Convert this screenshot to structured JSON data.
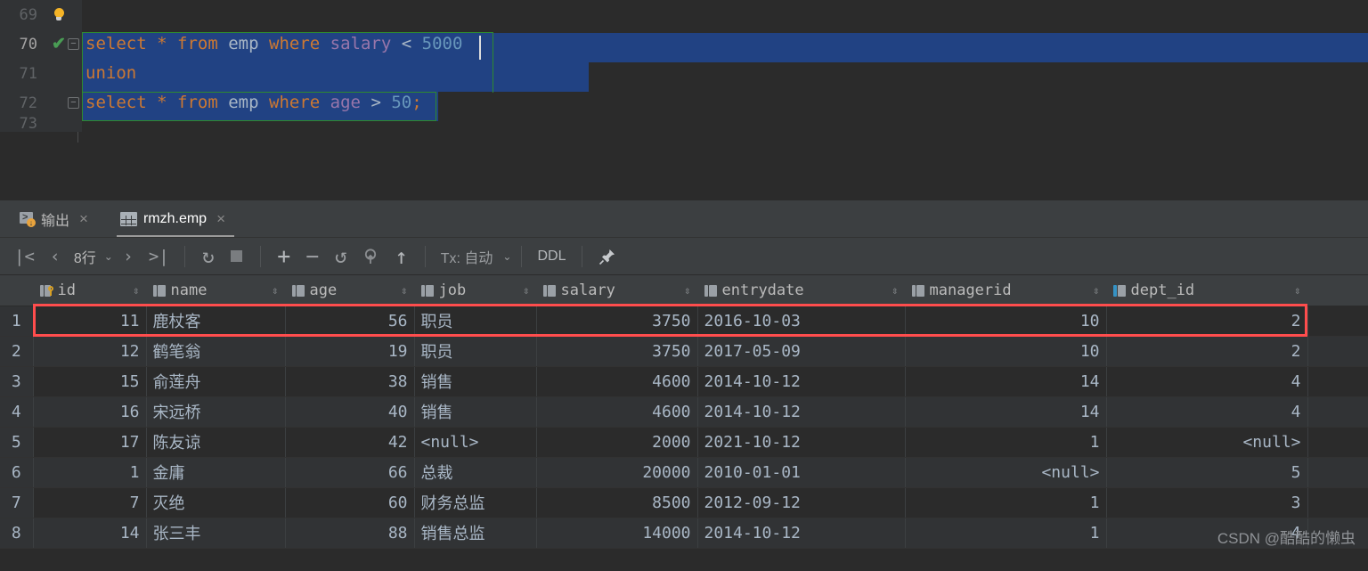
{
  "editor": {
    "lines": [
      {
        "number": "69",
        "gutter": "bulb-icon",
        "text": ""
      },
      {
        "number": "70",
        "gutter": "check-icon",
        "text": "select * from emp where salary < 5000"
      },
      {
        "number": "71",
        "gutter": "",
        "text": "union"
      },
      {
        "number": "72",
        "gutter": "fold-icon",
        "text": "select * from emp where age > 50;"
      },
      {
        "number": "73",
        "gutter": "",
        "text": ""
      }
    ],
    "line70": {
      "kw_select": "select",
      "star": "*",
      "kw_from": "from",
      "table": "emp",
      "kw_where": "where",
      "column": "salary",
      "operator": "<",
      "value": "5000"
    },
    "line71": {
      "kw_union": "union"
    },
    "line72": {
      "kw_select": "select",
      "star": "*",
      "kw_from": "from",
      "table": "emp",
      "kw_where": "where",
      "column": "age",
      "operator": ">",
      "value": "50",
      "semicolon": ";"
    },
    "colors": {
      "background": "#2b2b2b",
      "selection": "#214283",
      "keyword": "#cc7832",
      "number": "#6897bb",
      "column": "#9876aa",
      "identifier": "#a9b7c6",
      "statement_border": "#2e8b2e",
      "check": "#499c54"
    }
  },
  "tabs": {
    "items": [
      {
        "label": "输出",
        "icon": "output-icon",
        "close": "×",
        "active": false
      },
      {
        "label": "rmzh.emp",
        "icon": "table-grid-icon",
        "close": "×",
        "active": true
      }
    ]
  },
  "toolbar": {
    "first_page": "|<",
    "prev_page": "‹",
    "row_count": "8行",
    "row_count_caret": "⌄",
    "next_page": "›",
    "last_page": ">|",
    "reload": "↻",
    "stop": "stop-icon",
    "add_row": "+",
    "delete_row": "−",
    "revert": "↺",
    "find": "find-icon",
    "submit": "↑",
    "tx_label": "Tx: 自动",
    "tx_caret": "⌄",
    "ddl": "DDL",
    "pin": "pin-icon"
  },
  "grid": {
    "row_header": "",
    "columns": [
      {
        "name": "id",
        "icon": "primary-key-icon",
        "align": "right"
      },
      {
        "name": "name",
        "icon": "column-icon",
        "align": "left"
      },
      {
        "name": "age",
        "icon": "column-icon",
        "align": "right"
      },
      {
        "name": "job",
        "icon": "column-icon",
        "align": "left"
      },
      {
        "name": "salary",
        "icon": "column-icon",
        "align": "right"
      },
      {
        "name": "entrydate",
        "icon": "column-icon",
        "align": "left"
      },
      {
        "name": "managerid",
        "icon": "column-icon",
        "align": "right"
      },
      {
        "name": "dept_id",
        "icon": "foreign-key-icon",
        "align": "right"
      }
    ],
    "rows": [
      {
        "n": "1",
        "id": "11",
        "name": "鹿杖客",
        "age": "56",
        "job": "职员",
        "salary": "3750",
        "entrydate": "2016-10-03",
        "managerid": "10",
        "dept_id": "2"
      },
      {
        "n": "2",
        "id": "12",
        "name": "鹤笔翁",
        "age": "19",
        "job": "职员",
        "salary": "3750",
        "entrydate": "2017-05-09",
        "managerid": "10",
        "dept_id": "2"
      },
      {
        "n": "3",
        "id": "15",
        "name": "俞莲舟",
        "age": "38",
        "job": "销售",
        "salary": "4600",
        "entrydate": "2014-10-12",
        "managerid": "14",
        "dept_id": "4"
      },
      {
        "n": "4",
        "id": "16",
        "name": "宋远桥",
        "age": "40",
        "job": "销售",
        "salary": "4600",
        "entrydate": "2014-10-12",
        "managerid": "14",
        "dept_id": "4"
      },
      {
        "n": "5",
        "id": "17",
        "name": "陈友谅",
        "age": "42",
        "job": "<null>",
        "salary": "2000",
        "entrydate": "2021-10-12",
        "managerid": "1",
        "dept_id": "<null>"
      },
      {
        "n": "6",
        "id": "1",
        "name": "金庸",
        "age": "66",
        "job": "总裁",
        "salary": "20000",
        "entrydate": "2010-01-01",
        "managerid": "<null>",
        "dept_id": "5"
      },
      {
        "n": "7",
        "id": "7",
        "name": "灭绝",
        "age": "60",
        "job": "财务总监",
        "salary": "8500",
        "entrydate": "2012-09-12",
        "managerid": "1",
        "dept_id": "3"
      },
      {
        "n": "8",
        "id": "14",
        "name": "张三丰",
        "age": "88",
        "job": "销售总监",
        "salary": "14000",
        "entrydate": "2014-10-12",
        "managerid": "1",
        "dept_id": "4"
      }
    ],
    "highlight": {
      "row_index": 0,
      "color": "#ff4d4d"
    }
  },
  "watermark": {
    "text": "CSDN @酷酷的懒虫"
  }
}
